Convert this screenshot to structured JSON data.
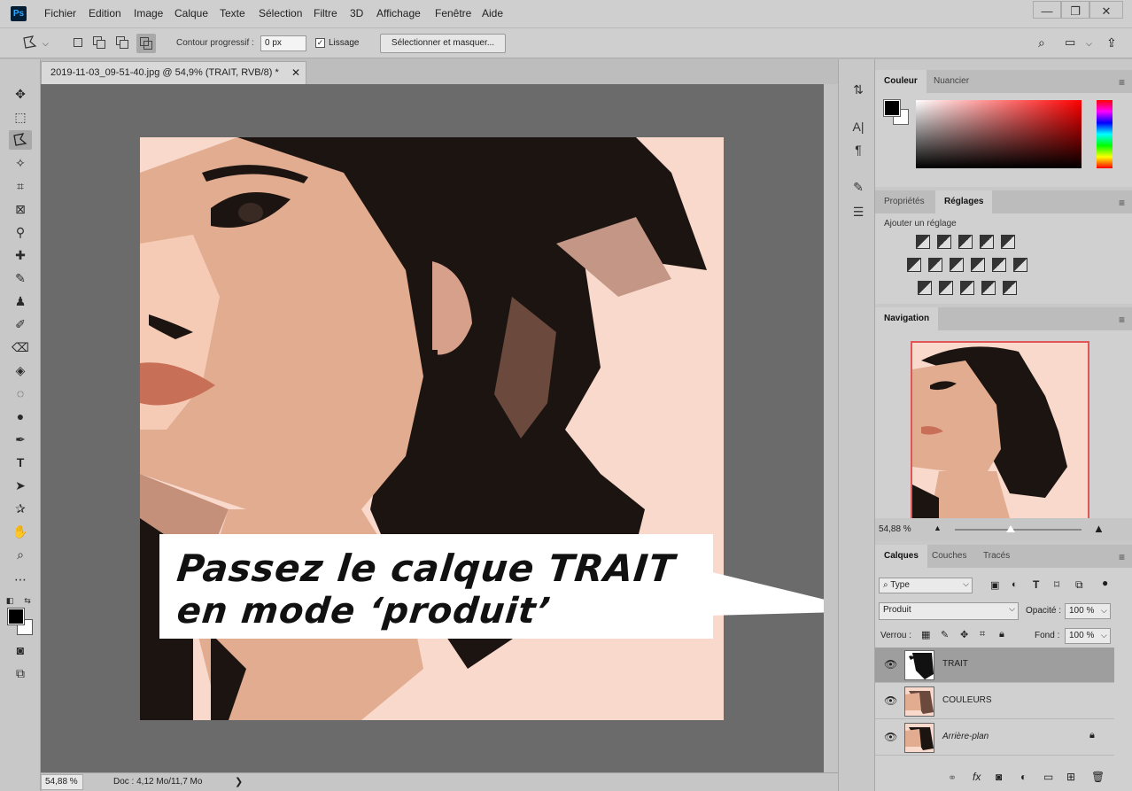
{
  "app": {
    "logo": "Ps"
  },
  "menu": [
    "Fichier",
    "Edition",
    "Image",
    "Calque",
    "Texte",
    "Sélection",
    "Filtre",
    "3D",
    "Affichage",
    "Fenêtre",
    "Aide"
  ],
  "window_controls": {
    "minimize": "—",
    "restore": "❐",
    "close": "✕"
  },
  "options": {
    "contour_label": "Contour progressif :",
    "contour_value": "0 px",
    "lissage_label": "Lissage",
    "select_mask_label": "Sélectionner et masquer..."
  },
  "document": {
    "tab_title": "2019-11-03_09-51-40.jpg @ 54,9% (TRAIT, RVB/8) *",
    "close": "✕",
    "status_zoom": "54,88 %",
    "status_info": "Doc : 4,12 Mo/11,7 Mo",
    "status_arrow": "❯"
  },
  "callout": {
    "line1": "Passez le calque TRAIT",
    "line2": "en mode ‘produit’"
  },
  "panels": {
    "color": {
      "tabs": [
        "Couleur",
        "Nuancier"
      ]
    },
    "adjustments": {
      "tabs": [
        "Propriétés",
        "Réglages"
      ],
      "label": "Ajouter un réglage"
    },
    "navigation": {
      "tab": "Navigation",
      "zoom": "54,88 %"
    },
    "layers": {
      "tabs": [
        "Calques",
        "Couches",
        "Tracés"
      ],
      "filter": "Type",
      "blend_mode": "Produit",
      "opacity_label": "Opacité :",
      "opacity_value": "100 %",
      "lock_label": "Verrou :",
      "fill_label": "Fond :",
      "fill_value": "100 %",
      "items": [
        {
          "name": "TRAIT",
          "selected": true
        },
        {
          "name": "COULEURS",
          "selected": false
        },
        {
          "name": "Arrière-plan",
          "selected": false,
          "locked": true
        }
      ]
    }
  },
  "icons": {
    "eye": "eye-icon",
    "lock": "lock-icon",
    "panel_menu": "hamburger-icon"
  }
}
